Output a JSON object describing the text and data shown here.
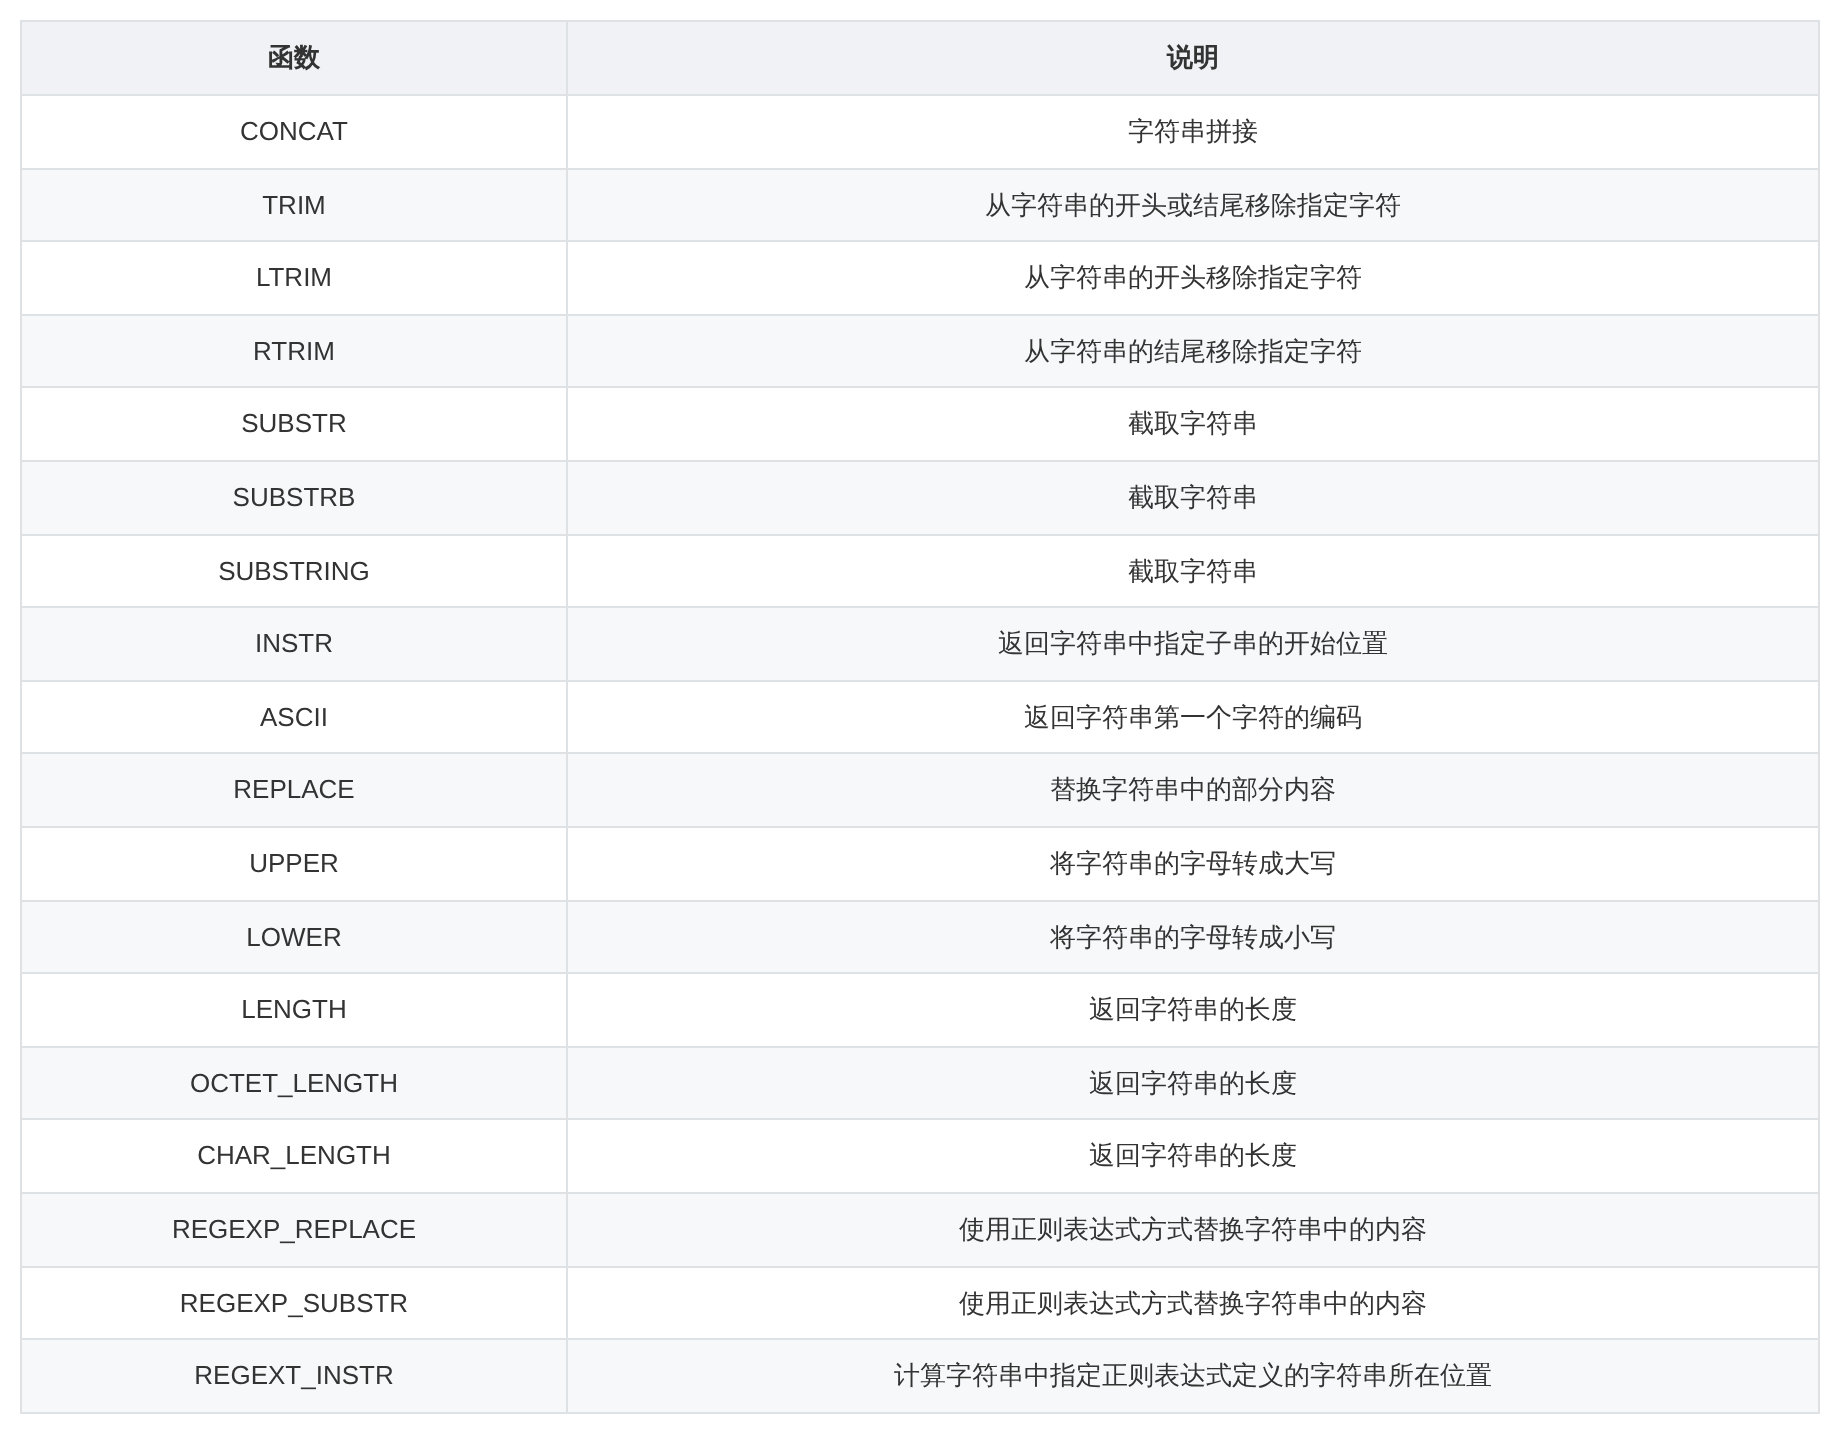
{
  "table": {
    "columns": [
      "函数",
      "说明"
    ],
    "rows": [
      [
        "CONCAT",
        "字符串拼接"
      ],
      [
        "TRIM",
        "从字符串的开头或结尾移除指定字符"
      ],
      [
        "LTRIM",
        "从字符串的开头移除指定字符"
      ],
      [
        "RTRIM",
        "从字符串的结尾移除指定字符"
      ],
      [
        "SUBSTR",
        "截取字符串"
      ],
      [
        "SUBSTRB",
        "截取字符串"
      ],
      [
        "SUBSTRING",
        "截取字符串"
      ],
      [
        "INSTR",
        "返回字符串中指定子串的开始位置"
      ],
      [
        "ASCII",
        "返回字符串第一个字符的编码"
      ],
      [
        "REPLACE",
        "替换字符串中的部分内容"
      ],
      [
        "UPPER",
        "将字符串的字母转成大写"
      ],
      [
        "LOWER",
        "将字符串的字母转成小写"
      ],
      [
        "LENGTH",
        "返回字符串的长度"
      ],
      [
        "OCTET_LENGTH",
        "返回字符串的长度"
      ],
      [
        "CHAR_LENGTH",
        "返回字符串的长度"
      ],
      [
        "REGEXP_REPLACE",
        "使用正则表达式方式替换字符串中的内容"
      ],
      [
        "REGEXP_SUBSTR",
        "使用正则表达式方式替换字符串中的内容"
      ],
      [
        "REGEXT_INSTR",
        "计算字符串中指定正则表达式定义的字符串所在位置"
      ]
    ]
  }
}
